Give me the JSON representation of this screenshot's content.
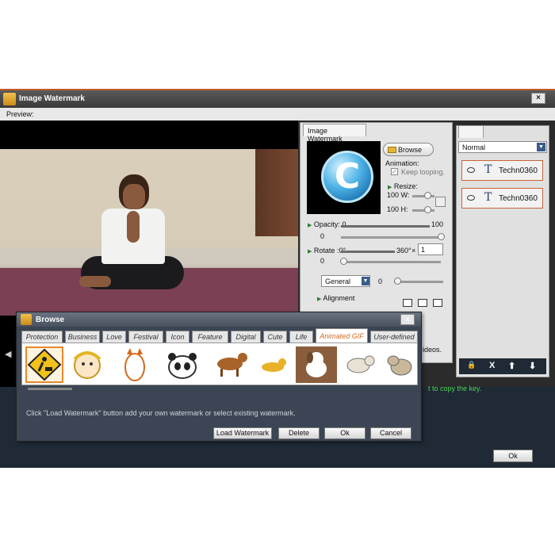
{
  "main": {
    "title": "Image Watermark",
    "close": "×",
    "preview_label": "Preview:",
    "key_hint": "t to copy the key.",
    "ok": "Ok"
  },
  "watermark_panel": {
    "tab": "Image Watermark",
    "browse": "Browse",
    "animation_label": "Animation:",
    "keep_looping": "Keep looping.",
    "keep_checked": "✓",
    "resize_label": "Resize:",
    "resize_w_value": "100",
    "resize_w_label": "W:",
    "resize_h_value": "100",
    "resize_h_label": "H:",
    "opacity_label": "Opacity:",
    "opacity_min": "0",
    "opacity_max": "100",
    "opacity_value": "0",
    "rotate_label": "Rotate",
    "rotate_min": ":0°",
    "rotate_max": "360°",
    "rotate_x": "×",
    "rotate_step": "1",
    "rotate_value": "0",
    "general": "General",
    "general_value": "0",
    "alignment_label": "Alignment",
    "ideos": "ideos."
  },
  "layers": {
    "blend_mode": "Normal",
    "items": [
      {
        "label": "Techn0360",
        "glyph": "T"
      },
      {
        "label": "Techn0360",
        "glyph": "T"
      }
    ],
    "tools": {
      "lock": "🔒",
      "delete": "X",
      "up": "⬆",
      "down": "⬇"
    }
  },
  "browse_dialog": {
    "title": "Browse",
    "close": "×",
    "tabs": [
      "Protection",
      "Business",
      "Love",
      "Festival",
      "Icon",
      "Feature",
      "Digital",
      "Cute",
      "Life",
      "Animated GIF",
      "User-defined"
    ],
    "active_tab": "Animated GIF",
    "hint": "Click \"Load Watermark\" button add your own watermark or select existing watermark.",
    "buttons": {
      "load": "Load Watermark",
      "delete": "Delete",
      "ok": "Ok",
      "cancel": "Cancel"
    }
  },
  "colors": {
    "accent": "#e7892b",
    "layer_border": "#c8643a",
    "dialog_bg": "#3b4553"
  }
}
